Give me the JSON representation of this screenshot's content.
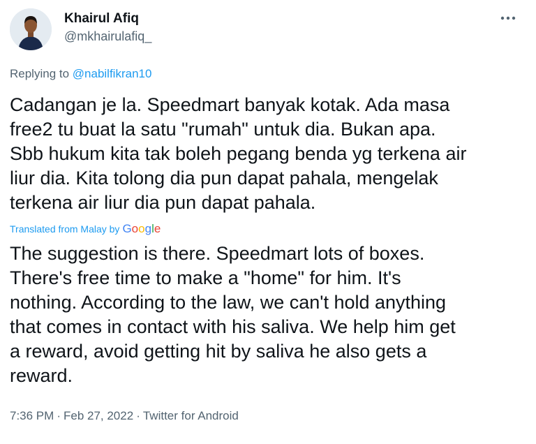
{
  "user": {
    "display_name": "Khairul Afiq",
    "handle": "@mkhairulafiq_"
  },
  "reply": {
    "prefix": "Replying to ",
    "mention": "@nabilfikran10"
  },
  "tweet": {
    "original_text": "Cadangan je la. Speedmart banyak kotak. Ada masa\nfree2 tu buat la satu \"rumah\" untuk dia. Bukan apa.\nSbb hukum kita tak boleh pegang benda yg terkena air\nliur dia. Kita tolong dia pun dapat pahala, mengelak\nterkena air liur dia pun dapat pahala.",
    "translated_label": "Translated from Malay by",
    "translator_brand": [
      "G",
      "o",
      "o",
      "g",
      "l",
      "e"
    ],
    "translation_text": "The suggestion is there. Speedmart lots of boxes.\nThere's free time to make a \"home\" for him. It's\nnothing. According to the law, we can't hold anything\nthat comes in contact with his saliva. We help him get\na reward, avoid getting hit by saliva he also gets a\nreward."
  },
  "meta": {
    "time": "7:36 PM",
    "date": "Feb 27, 2022",
    "source": "Twitter for Android",
    "separator": "·"
  },
  "colors": {
    "link": "#1d9bf0",
    "secondary_text": "#536471",
    "primary_text": "#0f1419",
    "google_blue": "#4285F4",
    "google_red": "#EA4335",
    "google_yellow": "#FBBC05",
    "google_green": "#34A853"
  },
  "icons": {
    "more": "more-options-icon",
    "avatar": "user-avatar"
  }
}
